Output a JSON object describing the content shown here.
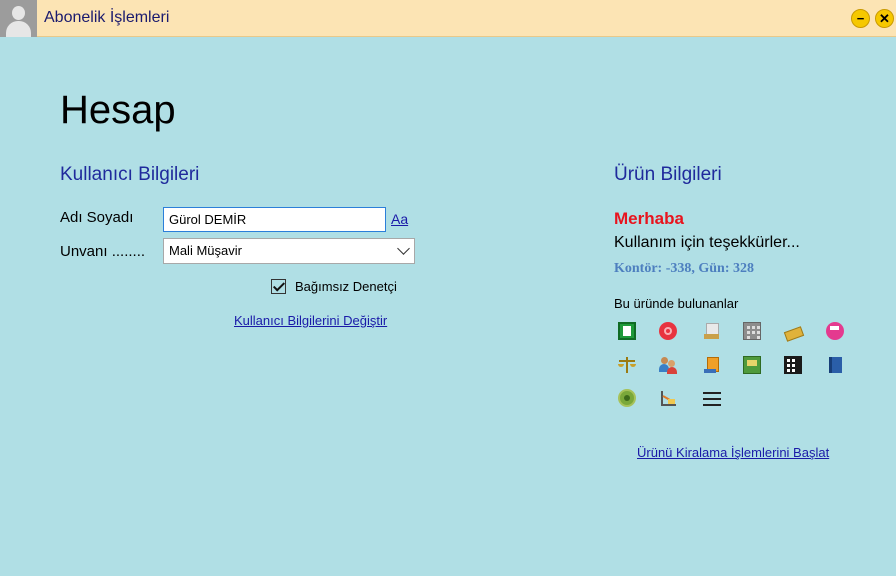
{
  "window": {
    "title": "Abonelik İşlemleri"
  },
  "page": {
    "heading": "Hesap"
  },
  "user_section": {
    "title": "Kullanıcı Bilgileri",
    "name_label": "Adı Soyadı",
    "name_value": "Gürol DEMİR",
    "font_link": "Aa",
    "title_label": "Unvanı ........",
    "title_value": "Mali Müşavir",
    "independent_auditor_label": "Bağımsız Denetçi",
    "independent_auditor_checked": true,
    "change_link": "Kullanıcı Bilgilerini Değiştir"
  },
  "product_section": {
    "title": "Ürün Bilgileri",
    "greeting": "Merhaba",
    "thanks": "Kullanım için teşekkürler...",
    "credit_text": "Kontör: -338, Gün: 328",
    "features_title": "Bu üründe bulunanlar",
    "feature_icons": [
      "green-ledger-icon",
      "red-circle-icon",
      "document-stack-icon",
      "building-icon",
      "money-bundle-icon",
      "pink-circle-icon",
      "scales-icon",
      "people-icon",
      "orange-document-icon",
      "image-file-icon",
      "calculator-icon",
      "blue-book-icon",
      "green-gear-icon",
      "chart-icon",
      "menu-icon"
    ],
    "start_rental_link": "Ürünü Kiralama İşlemlerini Başlat"
  },
  "colors": {
    "background": "#b0dfe5",
    "titlebar": "#fce4b4",
    "section_title": "#1f2a9c",
    "greeting": "#e8141e",
    "credit": "#4d7fbf",
    "link": "#1a1aa8"
  }
}
